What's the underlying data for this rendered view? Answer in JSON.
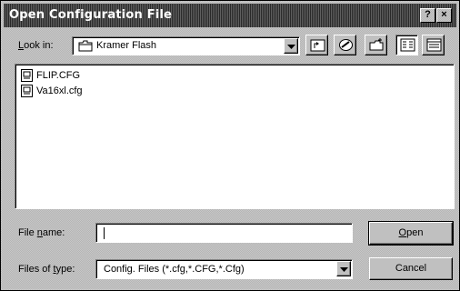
{
  "window": {
    "title": "Open Configuration File",
    "help_label": "?",
    "close_label": "×"
  },
  "lookin": {
    "label_underlined": "L",
    "label_rest": "ook in:",
    "value": "Kramer Flash"
  },
  "toolbar": {
    "icons": [
      "up-one-level-icon",
      "network-icon",
      "create-new-folder-icon",
      "list-view-icon",
      "details-view-icon"
    ]
  },
  "files": [
    {
      "name": "FLIP.CFG",
      "icon": "config-file-icon"
    },
    {
      "name": "Va16xl.cfg",
      "icon": "config-file-icon"
    }
  ],
  "filename": {
    "label_pre": "File ",
    "label_underlined": "n",
    "label_post": "ame:",
    "value": ""
  },
  "filetype": {
    "label_pre": "Files of ",
    "label_underlined": "t",
    "label_post": "ype:",
    "value": "Config. Files (*.cfg,*.CFG,*.Cfg)"
  },
  "buttons": {
    "open_underlined": "O",
    "open_rest": "pen",
    "cancel": "Cancel"
  },
  "colors": {
    "face": "#c0c0c0",
    "titlebar": "#2a2a2a",
    "window_bg": "#ffffff"
  }
}
